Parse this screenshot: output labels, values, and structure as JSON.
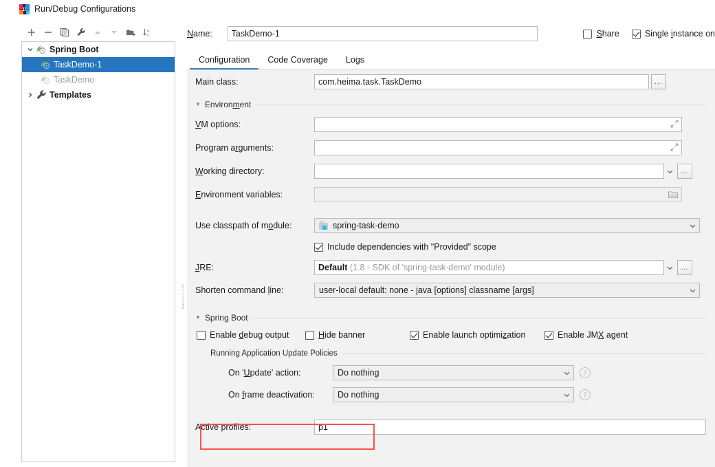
{
  "window": {
    "title": "Run/Debug Configurations",
    "logo_text": "IJ"
  },
  "toolbar": {
    "buttons": [
      {
        "name": "add",
        "label": "+"
      },
      {
        "name": "remove",
        "label": "−"
      },
      {
        "name": "copy",
        "label": "Copy"
      },
      {
        "name": "edit-templates",
        "label": "Edit Templates"
      },
      {
        "name": "move-up",
        "label": "Move Up"
      },
      {
        "name": "move-down",
        "label": "Move Down"
      },
      {
        "name": "new-folder",
        "label": "New Folder"
      },
      {
        "name": "sort-alphabetically",
        "label": "Sort Alphabetically"
      }
    ]
  },
  "tree": {
    "nodes": [
      {
        "label": "Spring Boot",
        "type": "group",
        "expanded": true,
        "bold": true,
        "muted": false,
        "selected": false,
        "indent": 0,
        "icon": "spring-boot-icon"
      },
      {
        "label": "TaskDemo-1",
        "type": "config",
        "expanded": null,
        "bold": false,
        "muted": false,
        "selected": true,
        "indent": 1,
        "icon": "spring-boot-icon"
      },
      {
        "label": "TaskDemo",
        "type": "config",
        "expanded": null,
        "bold": false,
        "muted": true,
        "selected": false,
        "indent": 1,
        "icon": "spring-boot-icon"
      },
      {
        "label": "Templates",
        "type": "group",
        "expanded": false,
        "bold": true,
        "muted": false,
        "selected": false,
        "indent": 0,
        "icon": "wrench-icon"
      }
    ]
  },
  "name_row": {
    "label": "Name:",
    "label_mnemonic": "N",
    "label_rest": "ame:",
    "value": "TaskDemo-1",
    "share": {
      "label": "Share",
      "mnemonic": "S",
      "rest": "hare",
      "checked": false
    },
    "single_instance": {
      "label": "Single instance on",
      "pre": "Single ",
      "mnemonic": "i",
      "rest": "nstance on",
      "checked": true
    }
  },
  "tabs": [
    {
      "label": "Configuration",
      "active": true
    },
    {
      "label": "Code Coverage",
      "active": false
    },
    {
      "label": "Logs",
      "active": false
    }
  ],
  "form": {
    "main_class": {
      "label": "Main class:",
      "value": "com.heima.task.TaskDemo",
      "browse": "..."
    },
    "environment_section": {
      "title": "Environment",
      "pre": "Environ",
      "mnemonic": "m",
      "rest": "ent"
    },
    "vm_options": {
      "label": "VM options:",
      "mnemonic": "V",
      "rest": "M options:",
      "value": ""
    },
    "program_arguments": {
      "label": "Program arguments:",
      "pre": "Program a",
      "mnemonic": "r",
      "rest": "guments:",
      "value": ""
    },
    "working_directory": {
      "label": "Working directory:",
      "mnemonic": "W",
      "rest": "orking directory:",
      "value": ""
    },
    "environment_variables": {
      "label": "Environment variables:",
      "mnemonic": "E",
      "rest": "nvironment variables:",
      "value": "",
      "disabled": true
    },
    "use_classpath": {
      "label": "Use classpath of module:",
      "pre": "Use classpath of m",
      "mnemonic": "o",
      "rest": "dule:",
      "value": "spring-task-demo"
    },
    "include_provided": {
      "label": "Include dependencies with \"Provided\" scope",
      "checked": true
    },
    "jre": {
      "label": "JRE:",
      "mnemonic": "J",
      "rest": "RE:",
      "value_strong": "Default",
      "value_dim": "(1.8 - SDK of 'spring-task-demo' module)",
      "browse": "..."
    },
    "shorten_command_line": {
      "label": "Shorten command line:",
      "pre": "Shorten command ",
      "mnemonic": "l",
      "rest": "ine:",
      "value_strong": "user-local default: none",
      "value_dim": "- java [options] classname [args]"
    }
  },
  "spring_boot_section": {
    "title": "Spring Boot",
    "pre": "Sprin",
    "mnemonic": "g",
    "rest": " Boot",
    "checkboxes": [
      {
        "label": "Enable debug output",
        "pre": "Enable ",
        "mnemonic": "d",
        "rest": "ebug output",
        "checked": false
      },
      {
        "label": "Hide banner",
        "pre": "",
        "mnemonic": "H",
        "rest": "ide banner",
        "checked": false
      },
      {
        "label": "Enable launch optimization",
        "pre": "Enable launch optimi",
        "mnemonic": "z",
        "rest": "ation",
        "checked": true
      },
      {
        "label": "Enable JMX agent",
        "pre": "Enable JM",
        "mnemonic": "X",
        "rest": " agent",
        "checked": true
      }
    ],
    "update_policies": {
      "title": "Running Application Update Policies",
      "on_update": {
        "label": "On 'Update' action:",
        "pre": "On '",
        "mnemonic": "U",
        "rest": "pdate' action:",
        "value": "Do nothing",
        "help": "?"
      },
      "on_frame_deactivation": {
        "label": "On frame deactivation:",
        "pre": "On ",
        "mnemonic": "f",
        "rest": "rame deactivation:",
        "value": "Do nothing",
        "help": "?"
      }
    }
  },
  "active_profiles": {
    "label": "Active profiles:",
    "value": "p1"
  },
  "annotation": {
    "color": "#f2544b"
  }
}
